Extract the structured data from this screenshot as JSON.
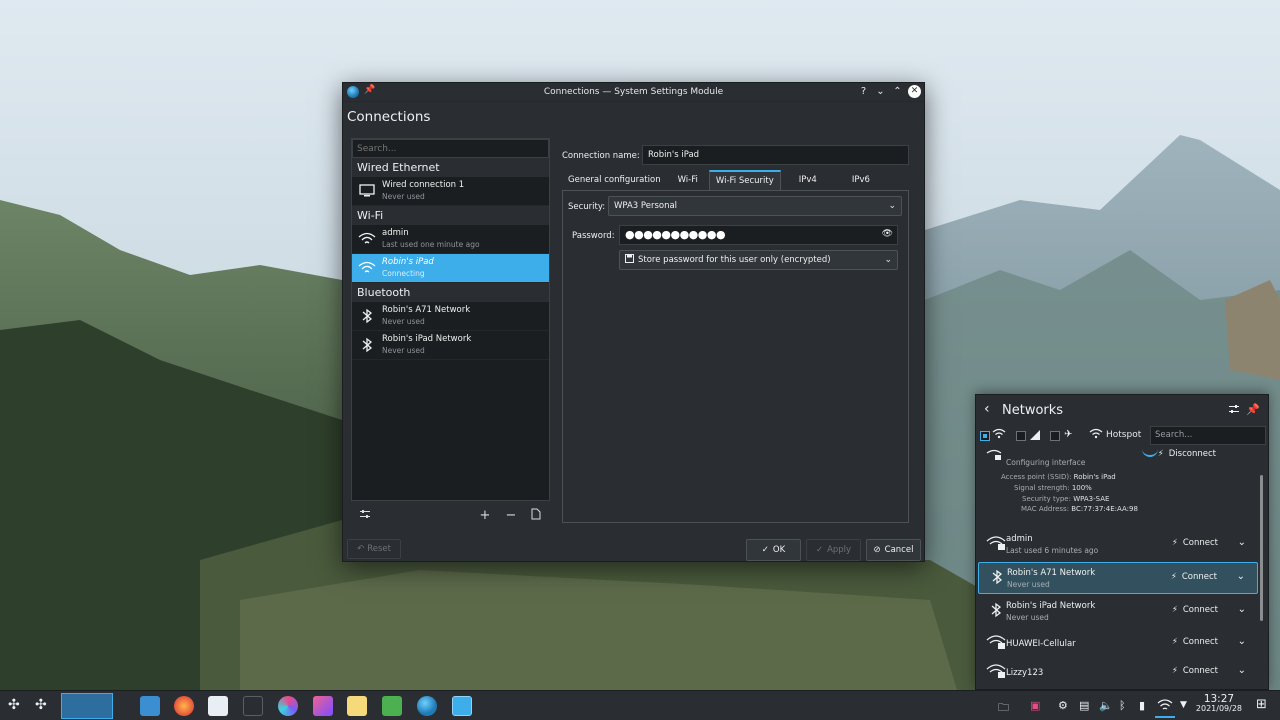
{
  "window": {
    "title": "Connections — System Settings Module",
    "heading": "Connections",
    "controls": {
      "help": "?",
      "minimize": "⌄",
      "maximize": "⌃",
      "close": "✕"
    }
  },
  "left_panel": {
    "search_placeholder": "Search...",
    "groups": [
      {
        "header": "Wired Ethernet",
        "items": [
          {
            "name": "Wired connection 1",
            "status": "Never used",
            "icon": "monitor-icon"
          }
        ]
      },
      {
        "header": "Wi-Fi",
        "items": [
          {
            "name": "admin",
            "status": "Last used one minute ago",
            "icon": "wifi-icon"
          },
          {
            "name": "Robin's iPad",
            "status": "Connecting",
            "icon": "wifi-icon",
            "selected": true
          }
        ]
      },
      {
        "header": "Bluetooth",
        "items": [
          {
            "name": "Robin's A71 Network",
            "status": "Never used",
            "icon": "bluetooth-icon"
          },
          {
            "name": "Robin's iPad Network",
            "status": "Never used",
            "icon": "bluetooth-icon"
          }
        ]
      }
    ]
  },
  "editor": {
    "connection_name_label": "Connection name:",
    "connection_name_value": "Robin's iPad",
    "tabs": [
      "General configuration",
      "Wi-Fi",
      "Wi-Fi Security",
      "IPv4",
      "IPv6"
    ],
    "active_tab": "Wi-Fi Security",
    "security_label": "Security:",
    "security_value": "WPA3 Personal",
    "password_label": "Password:",
    "password_dots": "●●●●●●●●●●●",
    "password_storage": "Store password for this user only (encrypted)"
  },
  "buttons": {
    "reset": "Reset",
    "ok": "OK",
    "apply": "Apply",
    "cancel": "Cancel"
  },
  "networks_popup": {
    "title": "Networks",
    "hotspot": "Hotspot",
    "search_placeholder": "Search...",
    "active": {
      "top_status": "Configuring interface",
      "disconnect": "Disconnect",
      "details": [
        {
          "label": "Access point (SSID):",
          "value": "Robin's iPad"
        },
        {
          "label": "Signal strength:",
          "value": "100%"
        },
        {
          "label": "Security type:",
          "value": "WPA3-SAE"
        },
        {
          "label": "MAC Address:",
          "value": "BC:77:37:4E:AA:98"
        }
      ]
    },
    "items": [
      {
        "name": "admin",
        "status": "Last used 6 minutes ago",
        "action": "Connect",
        "icon": "wifi-lock-icon"
      },
      {
        "name": "Robin's A71 Network",
        "status": "Never used",
        "action": "Connect",
        "icon": "bluetooth-icon",
        "highlighted": true
      },
      {
        "name": "Robin's iPad Network",
        "status": "Never used",
        "action": "Connect",
        "icon": "bluetooth-icon"
      },
      {
        "name": "HUAWEI-Cellular",
        "status": "",
        "action": "Connect",
        "icon": "wifi-lock-icon"
      },
      {
        "name": "Lizzy123",
        "status": "",
        "action": "Connect",
        "icon": "wifi-lock-icon"
      }
    ]
  },
  "taskbar": {
    "time": "13:27",
    "date": "2021/09/28"
  },
  "colors": {
    "accent": "#3daee9",
    "window_bg": "#2a2e32",
    "field_bg": "#1b1e20"
  }
}
